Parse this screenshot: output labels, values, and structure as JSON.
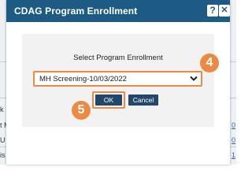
{
  "dialog": {
    "title": "CDAG Program Enrollment",
    "help_glyph": "?",
    "close_glyph": "✕",
    "prompt": "Select Program Enrollment",
    "select": {
      "value": "MH Screening-10/03/2022"
    },
    "ok_label": "OK",
    "cancel_label": "Cancel"
  },
  "callouts": {
    "step_4": "4",
    "step_5": "5"
  },
  "background": {
    "row_labels": [
      "k",
      "t M",
      "U",
      "is"
    ],
    "links": [
      "0",
      "0",
      "1"
    ]
  },
  "colors": {
    "titlebar": "#1d5b84",
    "accent": "#ec8a43",
    "button": "#23476a"
  }
}
